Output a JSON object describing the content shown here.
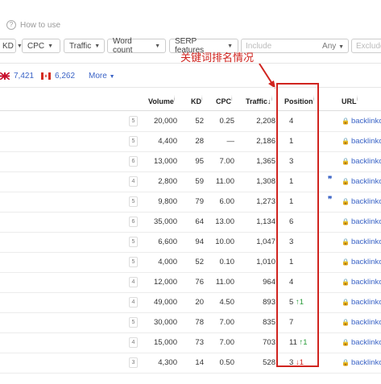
{
  "toolbar": {
    "how_to_use": "How to use",
    "filters": [
      {
        "label": "KD"
      },
      {
        "label": "CPC"
      },
      {
        "label": "Traffic"
      },
      {
        "label": "Word count"
      },
      {
        "label": "SERP features"
      }
    ],
    "include_placeholder": "Include",
    "any_label": "Any",
    "exclude_placeholder": "Exclude"
  },
  "annotation": "关键词排名情况",
  "countries": [
    {
      "value": "7,421",
      "flag": "uk"
    },
    {
      "value": "6,262",
      "flag": "ca"
    }
  ],
  "more_label": "More",
  "columns": {
    "volume": "Volume",
    "kd": "KD",
    "cpc": "CPC",
    "traffic": "Traffic",
    "position": "Position",
    "url": "URL"
  },
  "rows": [
    {
      "wc": "5",
      "volume": "20,000",
      "kd": "52",
      "cpc": "0.25",
      "traffic": "2,208",
      "position": "4",
      "change": "",
      "change_dir": "",
      "quote": false,
      "url": "backlinko"
    },
    {
      "wc": "5",
      "volume": "4,400",
      "kd": "28",
      "cpc": "—",
      "traffic": "2,186",
      "position": "1",
      "change": "",
      "change_dir": "",
      "quote": false,
      "url": "backlinko"
    },
    {
      "wc": "6",
      "volume": "13,000",
      "kd": "95",
      "cpc": "7.00",
      "traffic": "1,365",
      "position": "3",
      "change": "",
      "change_dir": "",
      "quote": false,
      "url": "backlinko"
    },
    {
      "wc": "4",
      "volume": "2,800",
      "kd": "59",
      "cpc": "11.00",
      "traffic": "1,308",
      "position": "1",
      "change": "",
      "change_dir": "",
      "quote": true,
      "url": "backlinko"
    },
    {
      "wc": "5",
      "volume": "9,800",
      "kd": "79",
      "cpc": "6.00",
      "traffic": "1,273",
      "position": "1",
      "change": "",
      "change_dir": "",
      "quote": true,
      "url": "backlinko"
    },
    {
      "wc": "6",
      "volume": "35,000",
      "kd": "64",
      "cpc": "13.00",
      "traffic": "1,134",
      "position": "6",
      "change": "",
      "change_dir": "",
      "quote": false,
      "url": "backlinko"
    },
    {
      "wc": "5",
      "volume": "6,600",
      "kd": "94",
      "cpc": "10.00",
      "traffic": "1,047",
      "position": "3",
      "change": "",
      "change_dir": "",
      "quote": false,
      "url": "backlinko"
    },
    {
      "wc": "5",
      "volume": "4,000",
      "kd": "52",
      "cpc": "0.10",
      "traffic": "1,010",
      "position": "1",
      "change": "",
      "change_dir": "",
      "quote": false,
      "url": "backlinko"
    },
    {
      "wc": "4",
      "volume": "12,000",
      "kd": "76",
      "cpc": "11.00",
      "traffic": "964",
      "position": "4",
      "change": "",
      "change_dir": "",
      "quote": false,
      "url": "backlinko"
    },
    {
      "wc": "4",
      "volume": "49,000",
      "kd": "20",
      "cpc": "4.50",
      "traffic": "893",
      "position": "5",
      "change": "1",
      "change_dir": "up",
      "quote": false,
      "url": "backlinko"
    },
    {
      "wc": "5",
      "volume": "30,000",
      "kd": "78",
      "cpc": "7.00",
      "traffic": "835",
      "position": "7",
      "change": "",
      "change_dir": "",
      "quote": false,
      "url": "backlinko"
    },
    {
      "wc": "4",
      "volume": "15,000",
      "kd": "73",
      "cpc": "7.00",
      "traffic": "703",
      "position": "11",
      "change": "1",
      "change_dir": "up",
      "quote": false,
      "url": "backlinko"
    },
    {
      "wc": "3",
      "volume": "4,300",
      "kd": "14",
      "cpc": "0.50",
      "traffic": "528",
      "position": "3",
      "change": "1",
      "change_dir": "down",
      "quote": false,
      "url": "backlinko"
    }
  ],
  "colors": {
    "accent": "#3a63c6",
    "annotation": "#d0241f",
    "up": "#2a9d3b",
    "down": "#d0241f"
  }
}
